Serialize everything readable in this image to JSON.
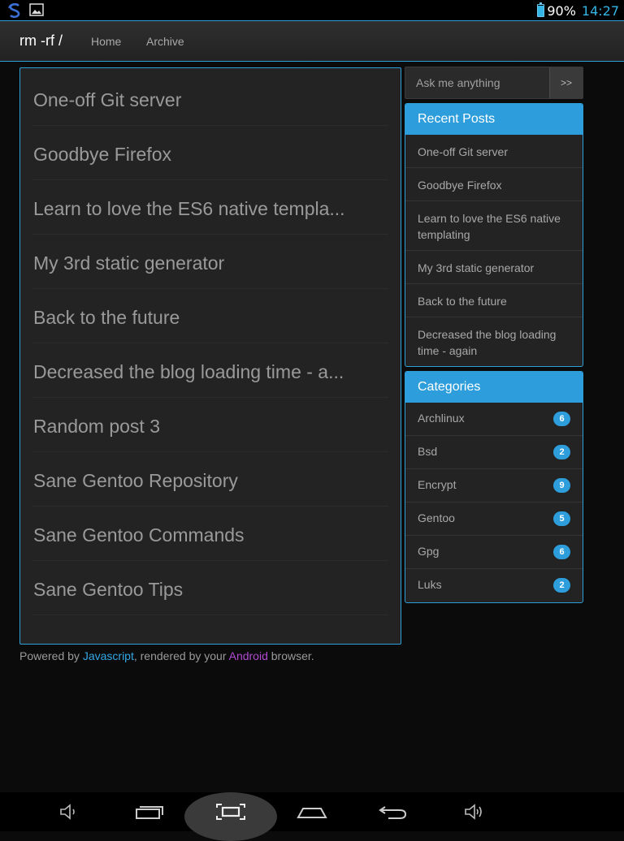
{
  "status": {
    "battery_level": 0.9,
    "battery_text": "90%",
    "time": "14:27"
  },
  "navbar": {
    "brand": "rm -rf /",
    "links": [
      "Home",
      "Archive"
    ]
  },
  "posts": [
    "One-off Git server",
    "Goodbye Firefox",
    "Learn to love the ES6 native templa...",
    "My 3rd static generator",
    "Back to the future",
    "Decreased the blog loading time - a...",
    "Random post 3",
    "Sane Gentoo Repository",
    "Sane Gentoo Commands",
    "Sane Gentoo Tips"
  ],
  "footer": {
    "prefix": "Powered by ",
    "js_link": "Javascript",
    "middle": ", rendered by your ",
    "android_link": "Android",
    "suffix": " browser."
  },
  "search": {
    "placeholder": "Ask me anything",
    "button": ">>"
  },
  "recent_posts": {
    "title": "Recent Posts",
    "items": [
      "One-off Git server",
      "Goodbye Firefox",
      "Learn to love the ES6 native templating",
      "My 3rd static generator",
      "Back to the future",
      "Decreased the blog loading time - again"
    ]
  },
  "categories": {
    "title": "Categories",
    "items": [
      {
        "name": "Archlinux",
        "count": "6"
      },
      {
        "name": "Bsd",
        "count": "2"
      },
      {
        "name": "Encrypt",
        "count": "9"
      },
      {
        "name": "Gentoo",
        "count": "5"
      },
      {
        "name": "Gpg",
        "count": "6"
      },
      {
        "name": "Luks",
        "count": "2"
      }
    ]
  },
  "colors": {
    "accent": "#2d9edb",
    "android_link": "#b04ad1"
  }
}
